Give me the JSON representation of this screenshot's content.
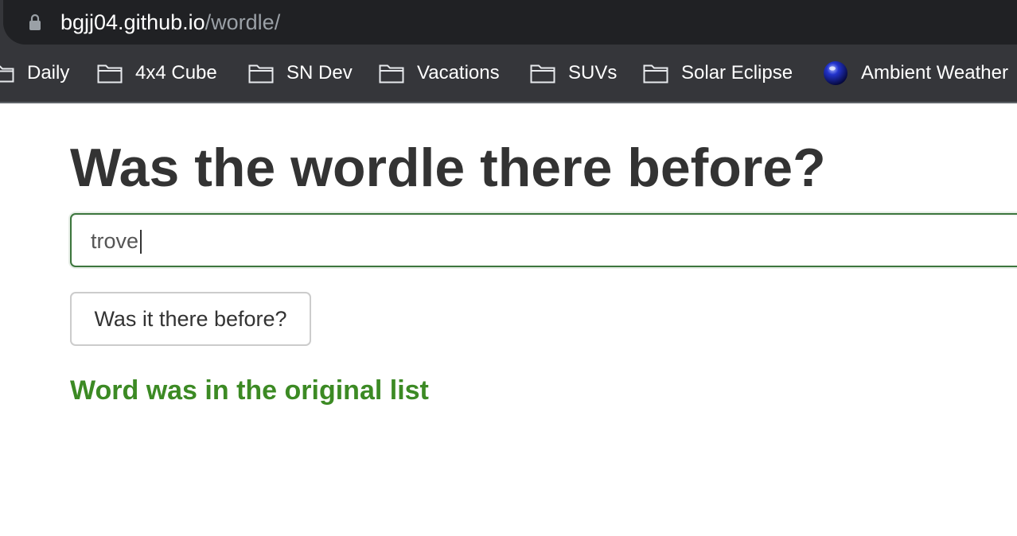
{
  "browser": {
    "url_host": "bgjj04.github.io",
    "url_path": "/wordle/",
    "lock_icon": "lock-icon",
    "bookmarks": [
      {
        "label": "Daily",
        "icon": "folder-icon"
      },
      {
        "label": "4x4 Cube",
        "icon": "folder-icon"
      },
      {
        "label": "SN Dev",
        "icon": "folder-icon"
      },
      {
        "label": "Vacations",
        "icon": "folder-icon"
      },
      {
        "label": "SUVs",
        "icon": "folder-icon"
      },
      {
        "label": "Solar Eclipse",
        "icon": "folder-icon"
      },
      {
        "label": "Ambient Weather",
        "icon": "blue-sphere-icon"
      }
    ]
  },
  "page": {
    "title": "Was the wordle there before?",
    "input_value": "trove",
    "button_label": "Was it there before?",
    "result": "Word was in the original list"
  },
  "colors": {
    "chrome_dark": "#202124",
    "chrome_bar": "#35363a",
    "title_text": "#333333",
    "success_green": "#3c8a24",
    "input_border_success": "#3c763d"
  }
}
